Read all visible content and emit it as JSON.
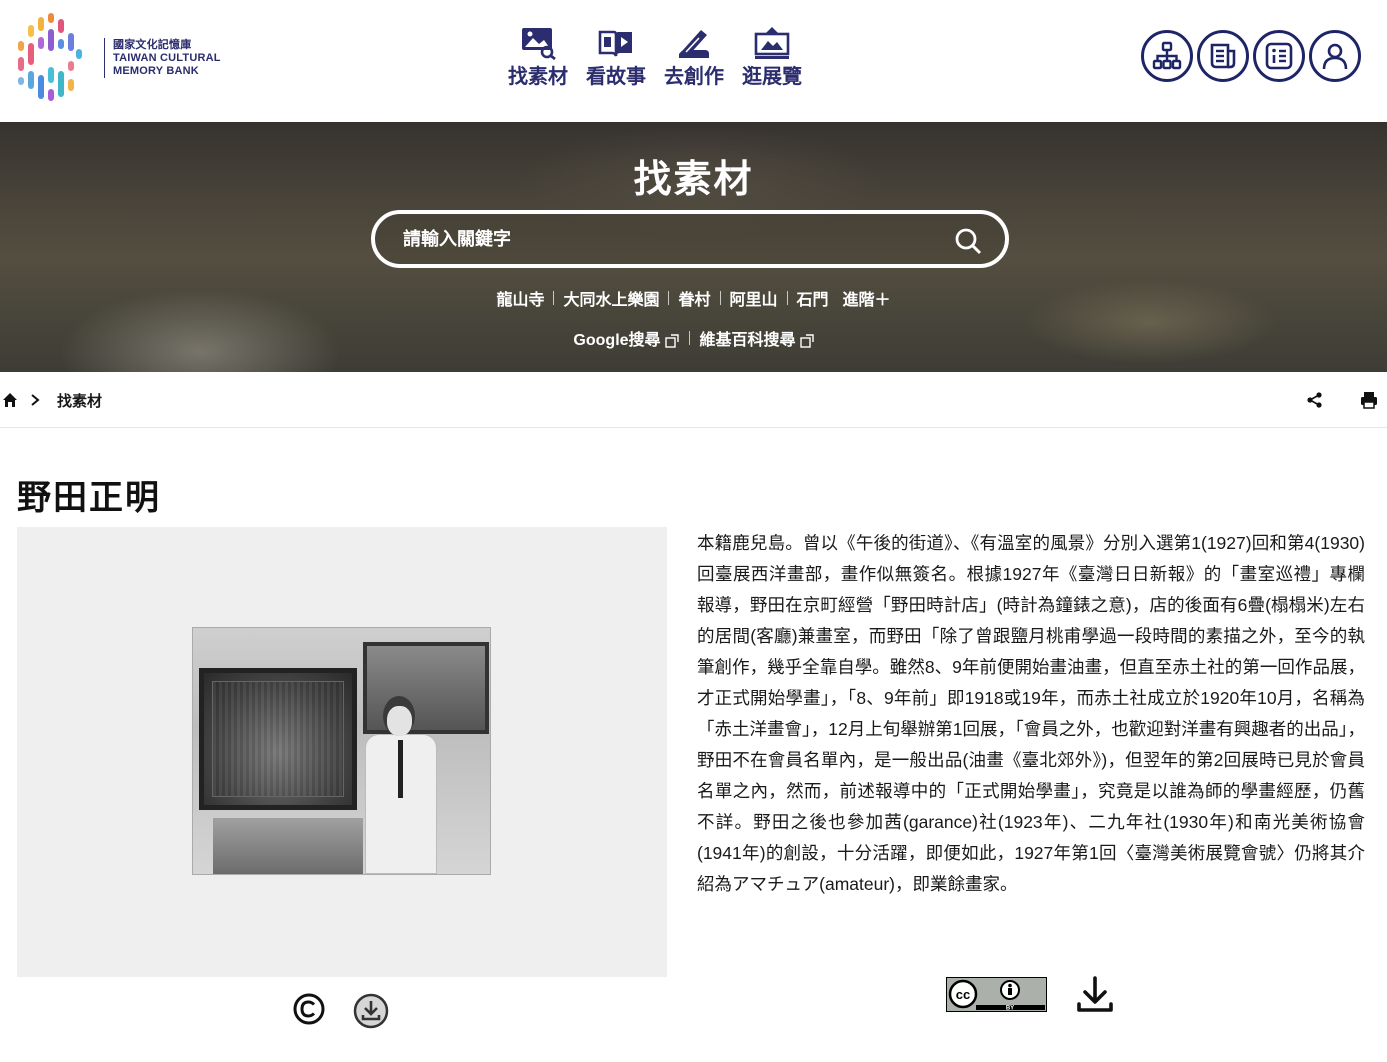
{
  "header": {
    "logo": {
      "line_zh": "國家文化記憶庫",
      "line_en1": "TAIWAN CULTURAL",
      "line_en2": "MEMORY BANK"
    },
    "nav": [
      {
        "label": "找素材",
        "icon": "image-search-icon"
      },
      {
        "label": "看故事",
        "icon": "book-play-icon"
      },
      {
        "label": "去創作",
        "icon": "pen-hand-icon"
      },
      {
        "label": "逛展覽",
        "icon": "gallery-icon"
      }
    ],
    "utility": [
      {
        "icon": "sitemap-icon"
      },
      {
        "icon": "news-icon"
      },
      {
        "icon": "info-icon"
      },
      {
        "icon": "user-icon"
      }
    ],
    "brand_color": "#2b2d6e"
  },
  "hero": {
    "title": "找素材",
    "search_placeholder": "請輸入關鍵字",
    "hot_keywords": [
      "龍山寺",
      "大同水上樂園",
      "眷村",
      "阿里山",
      "石門"
    ],
    "advanced_label": "進階＋",
    "external_search": [
      "Google搜尋",
      "維基百科搜尋"
    ]
  },
  "breadcrumb": {
    "current": "找素材"
  },
  "item": {
    "title": "野田正明",
    "description": "本籍鹿兒島。曾以《午後的街道》、《有溫室的風景》分別入選第1(1927)回和第4(1930)回臺展西洋畫部，畫作似無簽名。根據1927年《臺灣日日新報》的「畫室巡禮」專欄報導，野田在京町經營「野田時計店」(時計為鐘錶之意)，店的後面有6疊(榻榻米)左右的居間(客廳)兼畫室，而野田「除了曾跟鹽月桃甫學過一段時間的素描之外，至今的執筆創作，幾乎全靠自學。雖然8、9年前便開始畫油畫，但直至赤土社的第一回作品展，才正式開始學畫」，「8、9年前」即1918或19年，而赤土社成立於1920年10月，名稱為「赤土洋畫會」，12月上旬舉辦第1回展，「會員之外，也歡迎對洋畫有興趣者的出品」，野田不在會員名單內，是一般出品(油畫《臺北郊外》)，但翌年的第2回展時已見於會員名單之內，然而，前述報導中的「正式開始學畫」，究竟是以誰為師的學畫經歷，仍舊不詳。野田之後也參加茜(garance)社(1923年)、二九年社(1930年)和南光美術協會(1941年)的創設，十分活躍，即便如此，1927年第1回〈臺灣美術展覽會號〉仍將其介紹為アマチュア(amateur)，即業餘畫家。",
    "license_label": "BY"
  }
}
